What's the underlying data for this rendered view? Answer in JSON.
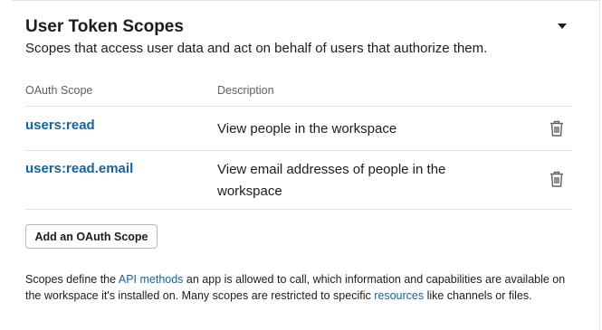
{
  "section": {
    "title": "User Token Scopes",
    "description": "Scopes that access user data and act on behalf of users that authorize them."
  },
  "table": {
    "headers": {
      "scope": "OAuth Scope",
      "description": "Description"
    },
    "rows": [
      {
        "scope": "users:read",
        "description": "View people in the workspace"
      },
      {
        "scope": "users:read.email",
        "description": "View email addresses of people in the workspace"
      }
    ]
  },
  "add_button_label": "Add an OAuth Scope",
  "footnote": {
    "part1": "Scopes define the ",
    "link1": "API methods",
    "part2": " an app is allowed to call, which information and capabilities are available on the workspace it's installed on. Many scopes are restricted to specific ",
    "link2": "resources",
    "part3": " like channels or files."
  },
  "icons": {
    "toggle": "caret-down-icon",
    "delete": "trash-icon"
  },
  "colors": {
    "link": "#1264a3",
    "text": "#1d1c1d",
    "muted": "#616061",
    "divider": "#e2e2e2"
  }
}
